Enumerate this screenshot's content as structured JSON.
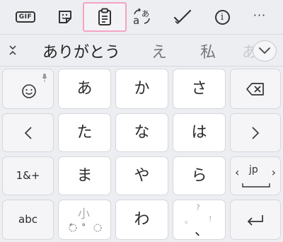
{
  "toolbar": {
    "gif_label": "GIF",
    "icons": [
      "gif-icon",
      "sticker-icon",
      "clipboard-icon",
      "translate-icon",
      "checkmark-icon",
      "info-icon",
      "more-icon"
    ],
    "info_glyph": "i",
    "more_glyph": "···",
    "active_color": "#f4a3c4"
  },
  "candidates": {
    "items": [
      "ありがとう",
      "え",
      "私",
      "あ"
    ]
  },
  "keys": {
    "row1": [
      "あ",
      "か",
      "さ"
    ],
    "row2": [
      "た",
      "な",
      "は"
    ],
    "row3": [
      "ま",
      "や",
      "ら"
    ],
    "row4": [
      "わ"
    ],
    "symbols_label": "1&+",
    "abc_label": "abc",
    "lang_label": "jp",
    "small_label": "小",
    "dakuten_label": "゛゜",
    "punct_label": "、",
    "punct_hints": [
      "?",
      "。",
      "!"
    ],
    "left_arrow": "‹",
    "right_arrow": "›",
    "lang_left": "‹",
    "lang_right": "›"
  }
}
